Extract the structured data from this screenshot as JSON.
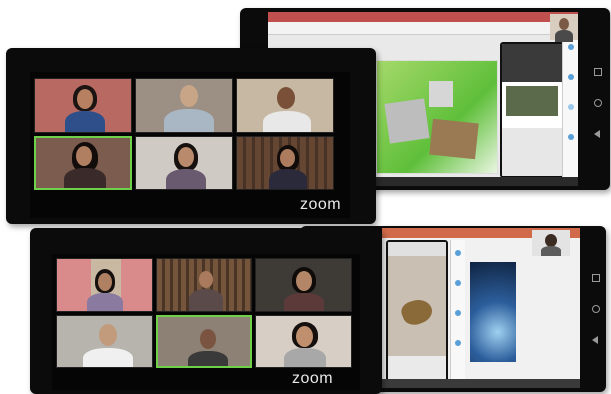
{
  "top_left_tablet": {
    "app_logo": "zoom",
    "participants": [
      {
        "name": "",
        "active": false
      },
      {
        "name": "",
        "active": false
      },
      {
        "name": "",
        "active": false
      },
      {
        "name": "",
        "active": true
      },
      {
        "name": "",
        "active": false
      },
      {
        "name": "",
        "active": false
      }
    ]
  },
  "bottom_left_tablet": {
    "app_logo": "zoom",
    "participants": [
      {
        "name": "",
        "active": false
      },
      {
        "name": "",
        "active": false
      },
      {
        "name": "",
        "active": false
      },
      {
        "name": "",
        "active": false
      },
      {
        "name": "",
        "active": true
      },
      {
        "name": "",
        "active": false
      }
    ]
  },
  "colors": {
    "zoom_active_border": "#6fd04a",
    "tablet_bezel": "#0b0b0b",
    "powerpoint_ribbon": "#c0504d"
  },
  "icons": [
    "nav-square-icon",
    "nav-home-icon",
    "nav-back-icon"
  ]
}
